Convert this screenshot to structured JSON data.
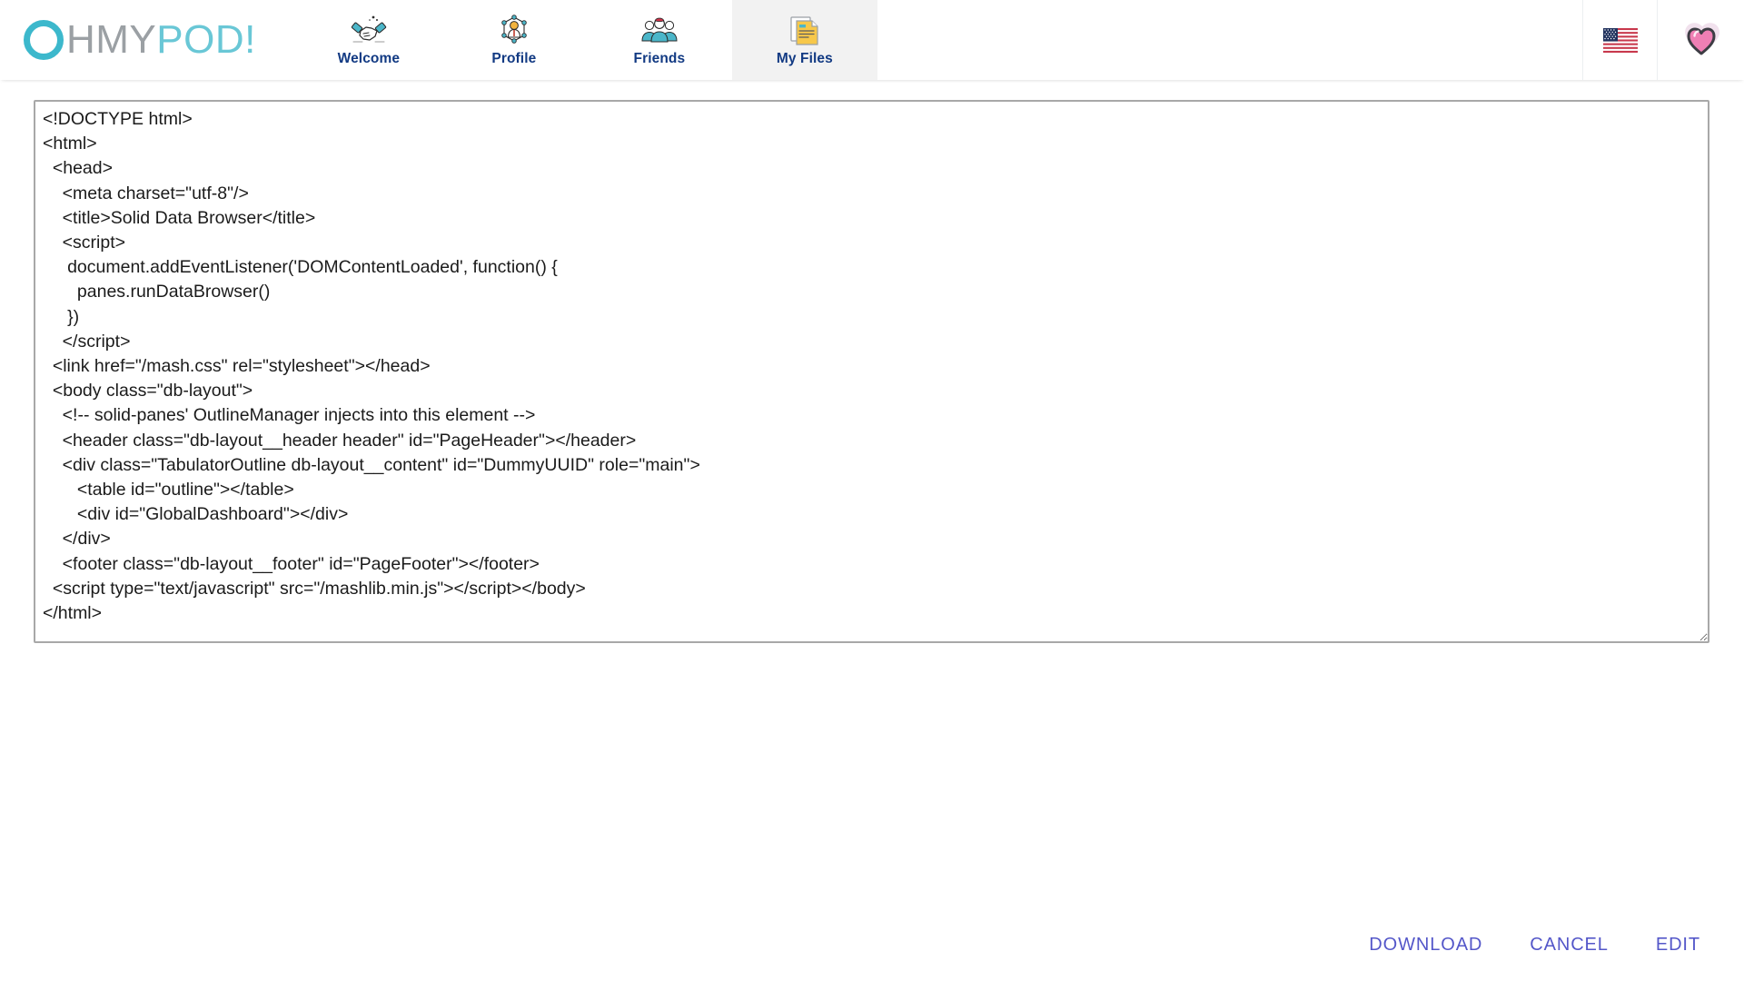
{
  "header": {
    "logo": {
      "icon": "ring-o-icon",
      "o_letter": "O",
      "mid_text": "HMY",
      "end_text": "POD!",
      "full_text": "OHMYPOD!",
      "teal": "#3cb8cc",
      "gray": "#9ba0a4",
      "light_teal": "#69c7d6"
    },
    "nav": [
      {
        "label": "Welcome",
        "icon": "handshake-icon",
        "active": false
      },
      {
        "label": "Profile",
        "icon": "person-network-icon",
        "active": false
      },
      {
        "label": "Friends",
        "icon": "people-group-icon",
        "active": false
      },
      {
        "label": "My Files",
        "icon": "documents-icon",
        "active": true
      }
    ],
    "nav_label_color": "#123a83",
    "active_tab_bg": "#f2f2f2",
    "language_flag": "us-flag-icon",
    "avatar": "pink-heart-icon"
  },
  "file_viewer": {
    "source_code": "<!DOCTYPE html>\n<html>\n  <head>\n    <meta charset=\"utf-8\"/>\n    <title>Solid Data Browser</title>\n    <script>\n     document.addEventListener('DOMContentLoaded', function() {\n       panes.runDataBrowser()\n     })\n    </script>\n  <link href=\"/mash.css\" rel=\"stylesheet\"></head>\n  <body class=\"db-layout\">\n    <!-- solid-panes' OutlineManager injects into this element -->\n    <header class=\"db-layout__header header\" id=\"PageHeader\"></header>\n    <div class=\"TabulatorOutline db-layout__content\" id=\"DummyUUID\" role=\"main\">\n       <table id=\"outline\"></table>\n       <div id=\"GlobalDashboard\"></div>\n    </div>\n    <footer class=\"db-layout__footer\" id=\"PageFooter\"></footer>\n  <script type=\"text/javascript\" src=\"/mashlib.min.js\"></script></body>\n</html>",
    "resize_handle": "resize-grip-icon",
    "actions": [
      {
        "label": "DOWNLOAD",
        "name": "download"
      },
      {
        "label": "CANCEL",
        "name": "cancel"
      },
      {
        "label": "EDIT",
        "name": "edit"
      }
    ],
    "action_color": "#5457c9"
  }
}
